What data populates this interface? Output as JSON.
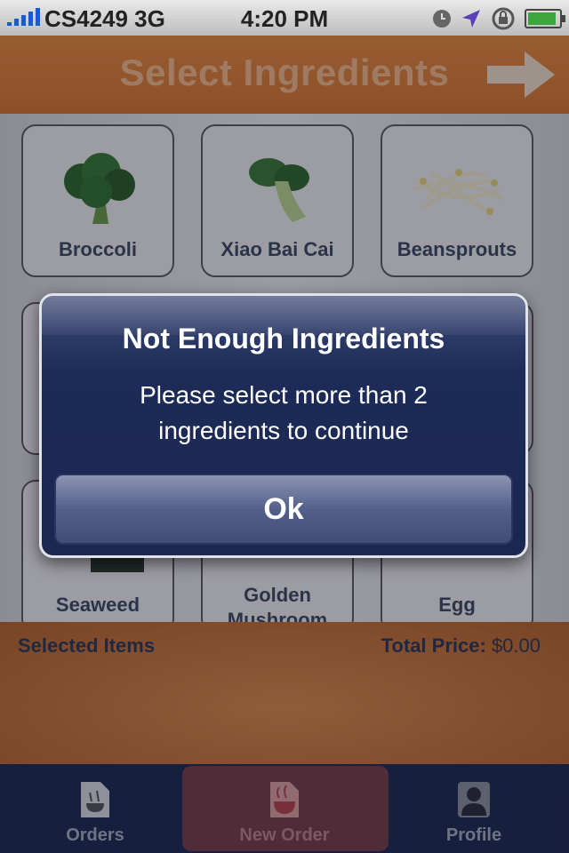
{
  "status_bar": {
    "carrier": "CS4249 3G",
    "time": "4:20 PM",
    "icons": [
      "signal-icon",
      "clock-icon",
      "location-icon",
      "rotation-lock-icon",
      "battery-icon"
    ],
    "battery_level": 0.9
  },
  "nav": {
    "title": "Select Ingredients",
    "next_icon": "right-arrow-icon"
  },
  "ingredients": [
    {
      "label": "Broccoli",
      "icon": "broccoli-icon"
    },
    {
      "label": "Xiao Bai Cai",
      "icon": "bok-choy-icon"
    },
    {
      "label": "Beansprouts",
      "icon": "beansprouts-icon"
    },
    {
      "label": "",
      "icon": ""
    },
    {
      "label": "",
      "icon": ""
    },
    {
      "label": "",
      "icon": ""
    },
    {
      "label": "Seaweed",
      "icon": "seaweed-icon"
    },
    {
      "label": "Golden Mushroom",
      "icon": "mushroom-icon"
    },
    {
      "label": "Egg",
      "icon": "egg-icon"
    }
  ],
  "alert": {
    "title": "Not Enough Ingredients",
    "message": "Please select more than 2 ingredients to continue",
    "ok_label": "Ok"
  },
  "footer": {
    "selected_label": "Selected Items",
    "total_label": "Total Price:",
    "total_value": "$0.00"
  },
  "tabs": [
    {
      "label": "Orders",
      "icon": "orders-icon",
      "active": false
    },
    {
      "label": "New Order",
      "icon": "new-order-icon",
      "active": true
    },
    {
      "label": "Profile",
      "icon": "profile-icon",
      "active": false
    }
  ],
  "colors": {
    "accent_orange": "#d6762f",
    "tab_bar": "#1f2b52",
    "alert_blue": "#1d2b58",
    "label_navy": "#3e4b60"
  }
}
